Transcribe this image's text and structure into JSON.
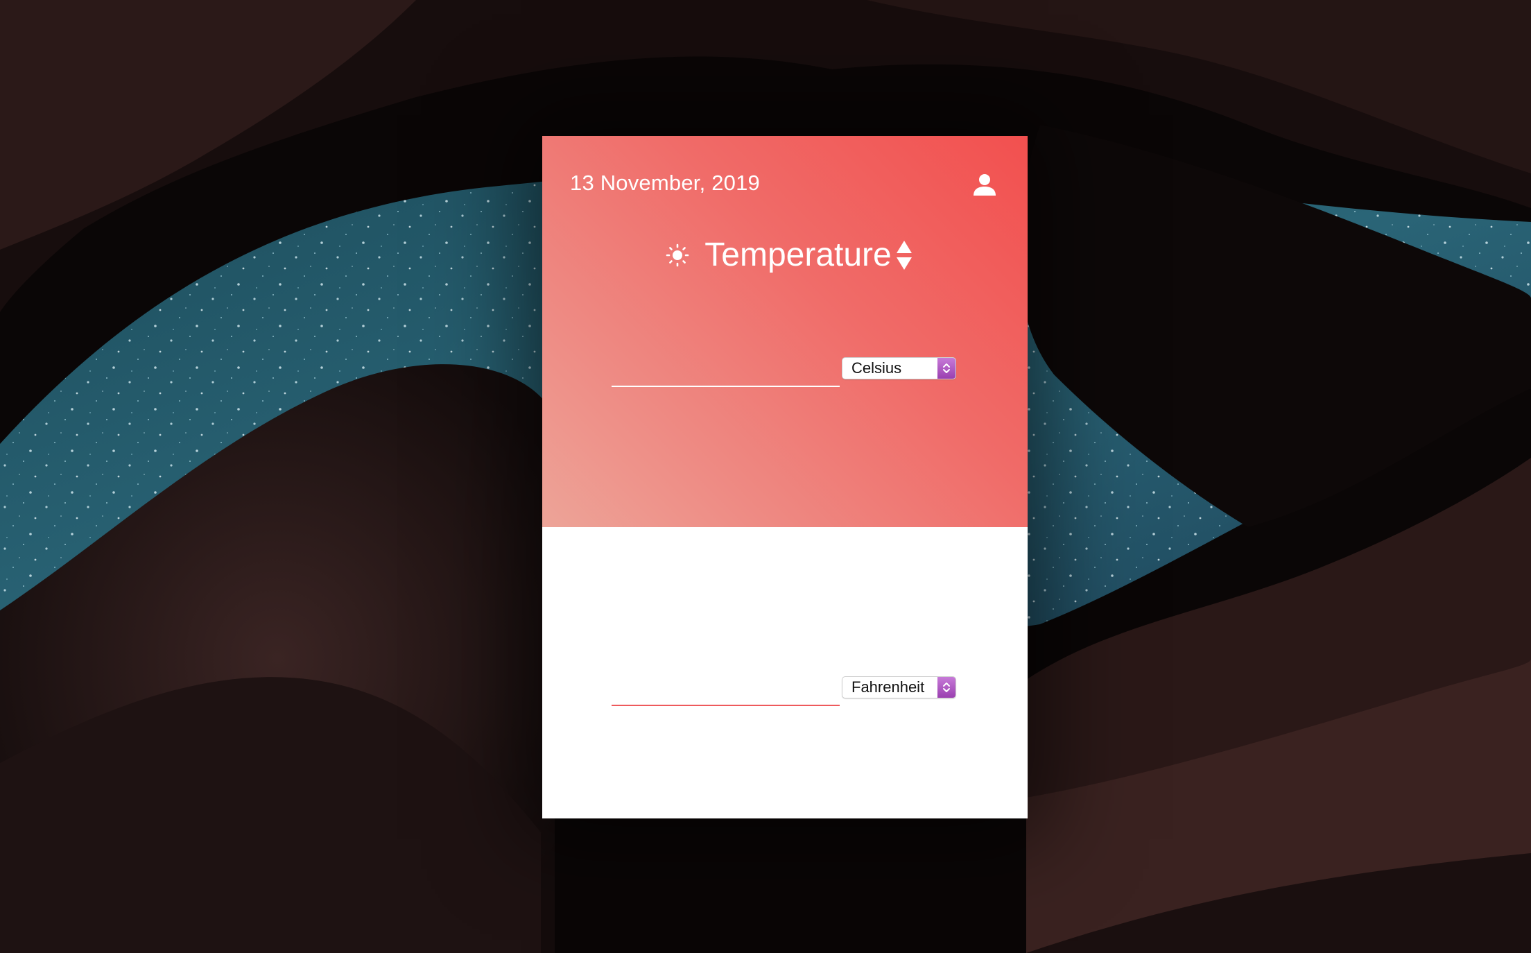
{
  "header": {
    "date": "13 November, 2019",
    "title": "Temperature"
  },
  "converter": {
    "top": {
      "value": "",
      "unit": "Celsius"
    },
    "bottom": {
      "value": "",
      "unit": "Fahrenheit"
    }
  },
  "colors": {
    "accent": "#f2504f",
    "gradient_light": "#eda498",
    "select_arrow": "#b35cc6",
    "panel_bottom": "#ffffff"
  },
  "icons": [
    "user-icon",
    "sun-icon",
    "sort-updown-icon",
    "select-chevron-icon"
  ]
}
